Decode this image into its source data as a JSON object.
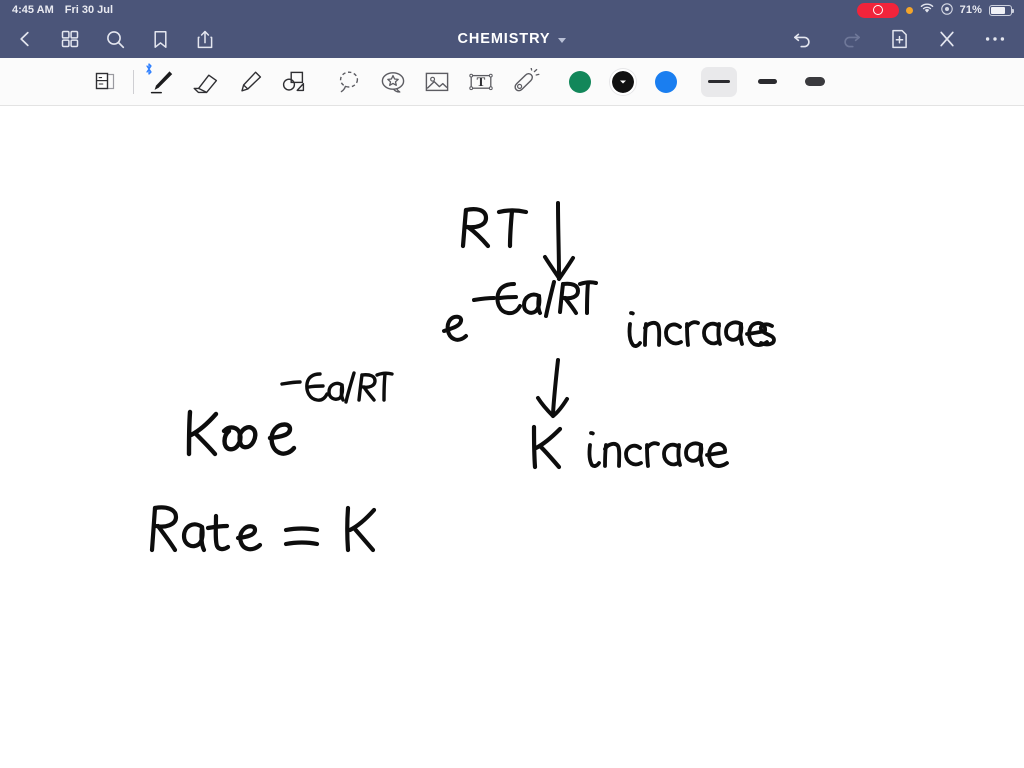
{
  "status_bar": {
    "time": "4:45 AM",
    "date": "Fri 30 Jul",
    "battery_percent": "71%",
    "icons": [
      "screen-recording-indicator",
      "orange-privacy-dot",
      "wifi-icon",
      "control-center-icon",
      "battery-icon"
    ],
    "background_color": "#4b5579"
  },
  "nav_bar": {
    "title": "CHEMISTRY",
    "title_chevron": "chevron-down-icon",
    "left_icons": [
      "back-chevron-icon",
      "grid-view-icon",
      "search-icon",
      "bookmark-icon",
      "share-icon"
    ],
    "right_icons": [
      "undo-icon",
      "redo-icon",
      "new-page-icon",
      "close-icon",
      "more-options-icon"
    ],
    "background_color": "#4b5579"
  },
  "tool_bar": {
    "tools": [
      {
        "name": "page-layers-icon",
        "label": "Page",
        "selected": false
      },
      {
        "name": "pen-icon",
        "label": "Pen",
        "selected": true,
        "badge": "bluetooth-icon"
      },
      {
        "name": "eraser-icon",
        "label": "Eraser",
        "selected": false
      },
      {
        "name": "highlighter-icon",
        "label": "Highlighter",
        "selected": false
      },
      {
        "name": "shapes-icon",
        "label": "Shapes",
        "selected": false
      },
      {
        "name": "lasso-icon",
        "label": "Lasso",
        "selected": false
      },
      {
        "name": "sticker-icon",
        "label": "Sticker",
        "selected": false
      },
      {
        "name": "image-icon",
        "label": "Image",
        "selected": false
      },
      {
        "name": "text-box-icon",
        "label": "Text",
        "selected": false
      },
      {
        "name": "laser-pointer-icon",
        "label": "Laser",
        "selected": false
      }
    ],
    "colors": [
      {
        "name": "color-green",
        "hex": "#12875a",
        "selected": false
      },
      {
        "name": "color-black",
        "hex": "#111111",
        "selected": true
      },
      {
        "name": "color-blue",
        "hex": "#1a7ef0",
        "selected": false
      }
    ],
    "stroke_widths": [
      {
        "name": "stroke-thin",
        "label": "Thin",
        "selected": true
      },
      {
        "name": "stroke-medium",
        "label": "Medium",
        "selected": false
      },
      {
        "name": "stroke-thick",
        "label": "Thick",
        "selected": false
      }
    ],
    "background_color": "#fbfbfb"
  },
  "canvas": {
    "background_color": "#ffffff",
    "ink_color": "#0d0d0d",
    "notes": [
      {
        "name": "note-rt",
        "text": "RT"
      },
      {
        "name": "note-arrow-1",
        "text": "↓"
      },
      {
        "name": "note-exp-ea-rt",
        "text": "e^-Ea/RT"
      },
      {
        "name": "note-increases",
        "text": "increases"
      },
      {
        "name": "note-arrow-2",
        "text": "↓"
      },
      {
        "name": "note-k-increase",
        "text": "K increase"
      },
      {
        "name": "note-superscript-ea-rt",
        "text": "-Ea/RT"
      },
      {
        "name": "note-k-prop-e",
        "text": "K∝ e"
      },
      {
        "name": "note-rate-equals-k",
        "text": "Rate = K"
      }
    ]
  }
}
